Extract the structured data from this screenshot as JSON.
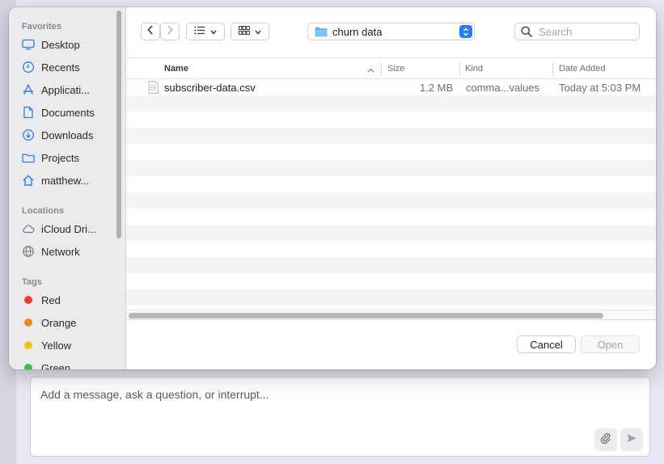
{
  "sidebar": {
    "sections": [
      {
        "label": "Favorites"
      },
      {
        "label": "Locations"
      },
      {
        "label": "Tags"
      }
    ],
    "favorites": [
      {
        "label": "Desktop",
        "icon": "desktop-icon"
      },
      {
        "label": "Recents",
        "icon": "clock-icon"
      },
      {
        "label": "Applicati...",
        "icon": "applications-icon"
      },
      {
        "label": "Documents",
        "icon": "document-icon"
      },
      {
        "label": "Downloads",
        "icon": "download-icon"
      },
      {
        "label": "Projects",
        "icon": "folder-icon"
      },
      {
        "label": "matthew...",
        "icon": "home-icon"
      }
    ],
    "locations": [
      {
        "label": "iCloud Dri...",
        "icon": "cloud-icon"
      },
      {
        "label": "Network",
        "icon": "globe-icon"
      }
    ],
    "tags": [
      {
        "label": "Red",
        "color": "#ee3b30"
      },
      {
        "label": "Orange",
        "color": "#f08a16"
      },
      {
        "label": "Yellow",
        "color": "#f5c20b"
      },
      {
        "label": "Green",
        "color": "#2fc548"
      }
    ]
  },
  "toolbar": {
    "path_folder": "churn data",
    "search_placeholder": "Search",
    "accent": "#2b7cf6"
  },
  "columns": {
    "name": "Name",
    "size": "Size",
    "kind": "Kind",
    "date_added": "Date Added"
  },
  "files": [
    {
      "name": "subscriber-data.csv",
      "size": "1.2 MB",
      "kind": "comma...values",
      "date_added": "Today at 5:03 PM"
    }
  ],
  "buttons": {
    "cancel": "Cancel",
    "open": "Open"
  },
  "composer": {
    "placeholder": "Add a message, ask a question, or interrupt..."
  }
}
